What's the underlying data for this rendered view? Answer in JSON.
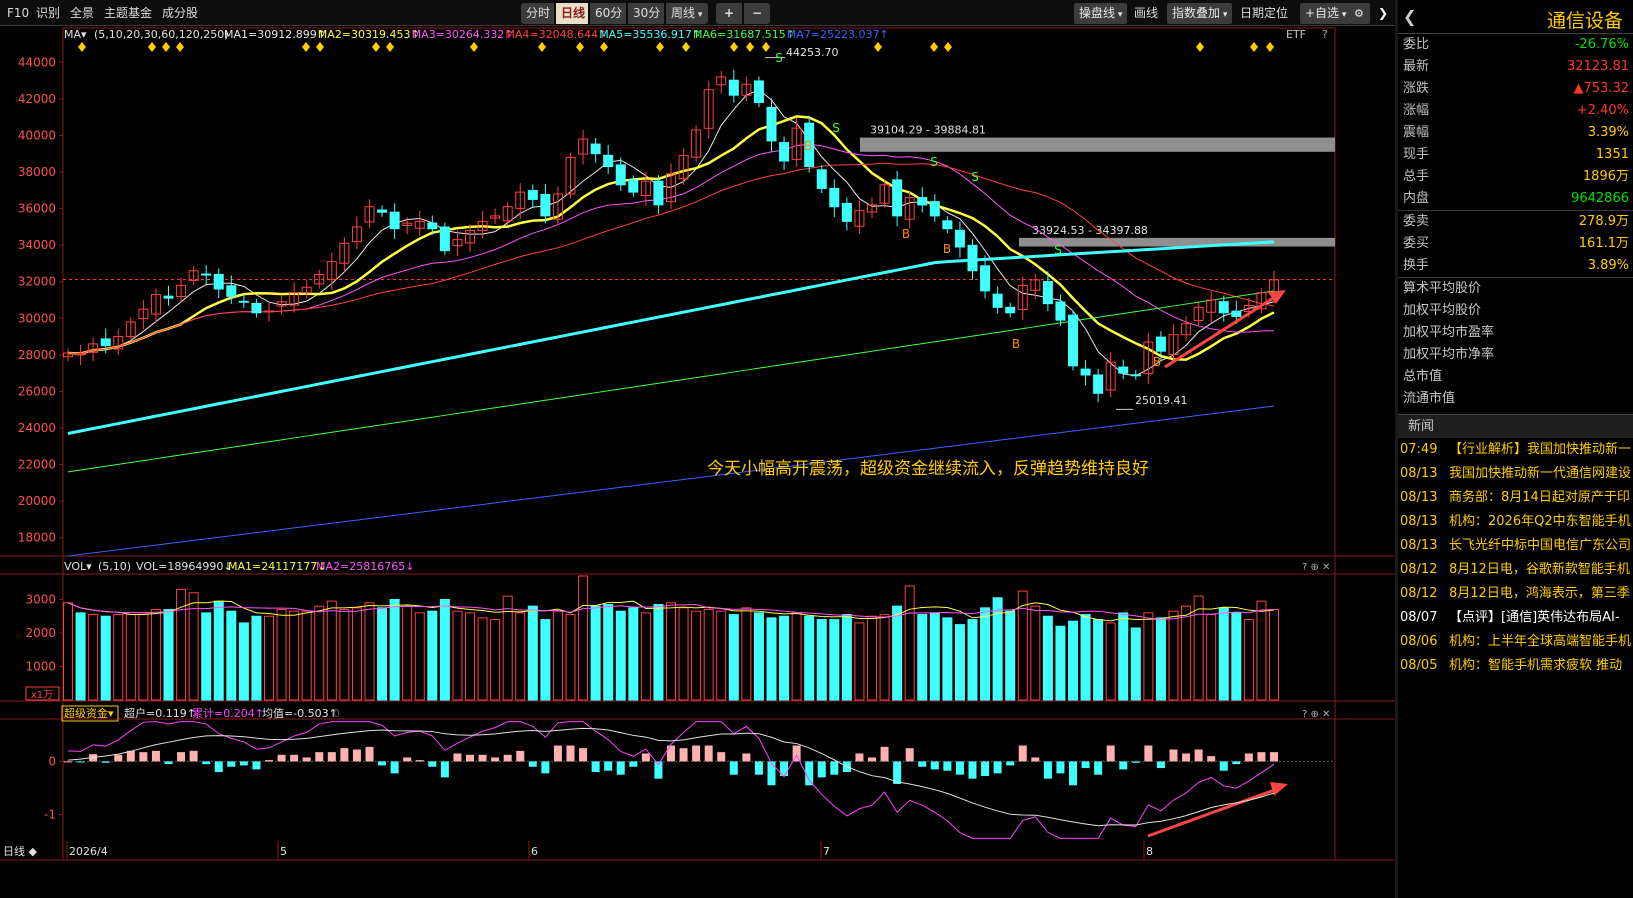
{
  "toolbar": {
    "f10": "F10",
    "identify": "识别",
    "overview": "全景",
    "theme_fund": "主题基金",
    "constituents": "成分股",
    "periods": [
      "分时",
      "日线",
      "60分",
      "30分"
    ],
    "period_drop": "周线",
    "zoom_in": "+",
    "zoom_out": "−",
    "tools": [
      "操盘线",
      "画线",
      "指数叠加",
      "日期定位",
      "+自选"
    ]
  },
  "stock": {
    "name": "通信设备",
    "quotes": [
      {
        "k": "委比",
        "v": "-26.76%",
        "c": "#00e000"
      },
      {
        "k": "最新",
        "v": "32123.81",
        "c": "#ff3333"
      },
      {
        "k": "涨跌",
        "v": "▲753.32",
        "c": "#ff3333"
      },
      {
        "k": "涨幅",
        "v": "+2.40%",
        "c": "#ff3333"
      },
      {
        "k": "震幅",
        "v": "3.39%",
        "c": "#ffcc00"
      },
      {
        "k": "现手",
        "v": "1351",
        "c": "#ffcc00"
      },
      {
        "k": "总手",
        "v": "1896万",
        "c": "#ffcc00"
      },
      {
        "k": "内盘",
        "v": "9642866",
        "c": "#00e000"
      }
    ],
    "quotes2": [
      {
        "k": "委卖",
        "v": "278.9万",
        "c": "#ffcc00"
      },
      {
        "k": "委买",
        "v": "161.1万",
        "c": "#ffcc00"
      },
      {
        "k": "换手",
        "v": "3.89%",
        "c": "#ffcc00"
      }
    ],
    "stats": [
      "算术平均股价",
      "加权平均股价",
      "加权平均市盈率",
      "加权平均市净率",
      "总市值",
      "流通市值"
    ]
  },
  "news": {
    "title": "新闻",
    "items": [
      {
        "date": "07:49",
        "text": "【行业解析】我国加快推动新一"
      },
      {
        "date": "08/13",
        "text": "我国加快推动新一代通信网建设"
      },
      {
        "date": "08/13",
        "text": "商务部：8月14日起对原产于印"
      },
      {
        "date": "08/13",
        "text": "机构：2026年Q2中东智能手机"
      },
      {
        "date": "08/13",
        "text": "长飞光纤中标中国电信广东公司"
      },
      {
        "date": "08/12",
        "text": "8月12日电，谷歌新款智能手机"
      },
      {
        "date": "08/12",
        "text": "8月12日电，鸿海表示，第三季"
      },
      {
        "date": "08/07",
        "text": "【点评】[通信]英伟达布局AI-"
      },
      {
        "date": "08/06",
        "text": "机构：上半年全球高端智能手机"
      },
      {
        "date": "08/05",
        "text": "机构：智能手机需求疲软 推动"
      }
    ]
  },
  "main_panel": {
    "ma_label": "MA",
    "ma_params": "(5,10,20,30,60,120,250)",
    "ma_values": [
      {
        "text": "MA1=30912.899",
        "c": "#e8e8e8"
      },
      {
        "text": "MA2=30319.453",
        "c": "#ffff40"
      },
      {
        "text": "MA3=30264.332",
        "c": "#ff55ff"
      },
      {
        "text": "MA4=32048.644",
        "c": "#ff4040"
      },
      {
        "text": "MA5=35536.917",
        "c": "#40ffff"
      },
      {
        "text": "MA6=31687.515",
        "c": "#40ff40"
      },
      {
        "text": "MA7=25223.037",
        "c": "#4060ff"
      }
    ],
    "etf": "ETF",
    "annotation": "今天小幅高开震荡，超级资金继续流入，反弹趋势维持良好",
    "levels": [
      {
        "label": "39104.29 - 39884.81",
        "lo": 39104.29,
        "hi": 39884.81
      },
      {
        "label": "33924.53 - 34397.88",
        "lo": 33924.53,
        "hi": 34397.88
      }
    ],
    "high_label": "44253.70",
    "low_label": "25019.41"
  },
  "vol_panel": {
    "label": "VOL",
    "params": "(5,10)",
    "vol": "VOL=18964990",
    "ma1": "MA1=24117177",
    "ma2": "MA2=25816765",
    "unit": "x1万"
  },
  "fund_panel": {
    "label": "超级资金",
    "super": "超户=0.119",
    "cum": "累计=0.204",
    "avg": "均值=-0.503",
    "zero": "0"
  },
  "dates": {
    "label": "日线",
    "ticks": [
      "2026/4",
      "5",
      "6",
      "7",
      "8"
    ]
  },
  "chart_data": {
    "type": "candlestick",
    "title": "通信设备 日线",
    "y_range": [
      17000,
      45000
    ],
    "y_ticks": [
      18000,
      20000,
      22000,
      24000,
      26000,
      28000,
      30000,
      32000,
      34000,
      36000,
      38000,
      40000,
      42000,
      44000
    ],
    "closes": [
      28100,
      28050,
      28600,
      28500,
      29000,
      29800,
      30500,
      31300,
      31100,
      31800,
      32600,
      32400,
      31600,
      31200,
      30900,
      30300,
      30400,
      30900,
      31400,
      31700,
      32400,
      33100,
      34100,
      35000,
      36100,
      35800,
      34900,
      35200,
      35300,
      34900,
      33700,
      34300,
      34800,
      35300,
      35600,
      36100,
      36900,
      36500,
      35600,
      36800,
      38800,
      39800,
      39000,
      38300,
      37300,
      36900,
      37500,
      36200,
      37900,
      38900,
      40300,
      42500,
      43200,
      42200,
      42800,
      41800,
      39700,
      38600,
      40400,
      38300,
      37100,
      36100,
      35300,
      35900,
      36200,
      37300,
      35600,
      36600,
      36200,
      35600,
      34900,
      33900,
      32600,
      31500,
      30600,
      30300,
      31800,
      32100,
      30800,
      29900,
      27400,
      26900,
      25900,
      27600,
      27000,
      26900,
      28700,
      28200,
      29100,
      29700,
      30600,
      31000,
      30300,
      30100,
      30700,
      31400,
      32100
    ],
    "vol_range": [
      0,
      3700
    ],
    "vol_ticks": [
      1000,
      2000,
      3000
    ],
    "volumes": [
      2900,
      2600,
      2550,
      2500,
      2550,
      2550,
      2600,
      2700,
      2700,
      3300,
      3200,
      2600,
      2950,
      2650,
      2300,
      2500,
      2500,
      2700,
      2650,
      2650,
      2800,
      2950,
      2700,
      2750,
      2900,
      2750,
      3000,
      2800,
      2600,
      2650,
      3000,
      2650,
      2600,
      2450,
      2400,
      3100,
      2600,
      2800,
      2400,
      2650,
      2550,
      3700,
      2800,
      2850,
      2650,
      2750,
      2600,
      2850,
      2900,
      2750,
      2650,
      2700,
      2650,
      2550,
      2750,
      2600,
      2450,
      2500,
      2600,
      2500,
      2400,
      2400,
      2550,
      2300,
      2500,
      2550,
      2800,
      3400,
      2550,
      2600,
      2450,
      2250,
      2400,
      2750,
      3050,
      2650,
      3250,
      2800,
      2500,
      2200,
      2350,
      2550,
      2400,
      2300,
      2600,
      2150,
      2600,
      2450,
      2650,
      2800,
      3100,
      2550,
      2750,
      2600,
      2400,
      2950,
      2700
    ],
    "fund_range": [
      -1.5,
      0.8
    ],
    "fund_ticks": [
      0,
      -1
    ]
  }
}
